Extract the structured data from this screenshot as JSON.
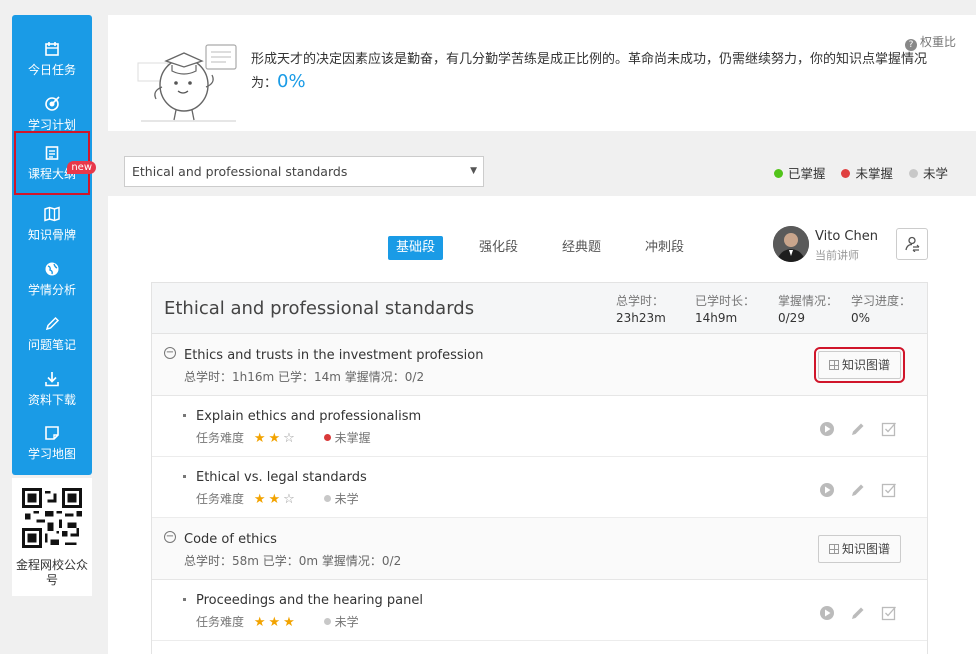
{
  "sidebar": {
    "items": [
      {
        "label": "今日任务",
        "icon": "calendar-icon"
      },
      {
        "label": "学习计划",
        "icon": "target-icon"
      },
      {
        "label": "课程大纲",
        "icon": "outline-icon",
        "badge": "new",
        "highlighted": true
      },
      {
        "label": "知识骨牌",
        "icon": "map-icon"
      },
      {
        "label": "学情分析",
        "icon": "globe-icon"
      },
      {
        "label": "问题笔记",
        "icon": "pencil-icon"
      },
      {
        "label": "资料下载",
        "icon": "download-icon"
      },
      {
        "label": "学习地图",
        "icon": "map-note-icon"
      }
    ],
    "qr_label": "金程网校公众号"
  },
  "banner": {
    "message": "形成天才的决定因素应该是勤奋，有几分勤学苦练是成正比例的。革命尚未成功，仍需继续努力，你的知识点掌握情况为：",
    "percent": "0%",
    "weight_link": "权重比"
  },
  "filter": {
    "selected_subject": "Ethical and professional standards",
    "legend": [
      {
        "label": "已掌握",
        "color": "#52c41a"
      },
      {
        "label": "未掌握",
        "color": "#e04040"
      },
      {
        "label": "未学",
        "color": "#c8c8c8"
      }
    ]
  },
  "tabs": [
    {
      "label": "基础段",
      "active": true
    },
    {
      "label": "强化段",
      "active": false
    },
    {
      "label": "经典题",
      "active": false
    },
    {
      "label": "冲刺段",
      "active": false
    }
  ],
  "lecturer": {
    "name": "Vito Chen",
    "role": "当前讲师"
  },
  "course": {
    "title": "Ethical and professional standards",
    "stats": [
      {
        "label": "总学时：",
        "value": "23h23m"
      },
      {
        "label": "已学时长：",
        "value": "14h9m"
      },
      {
        "label": "掌握情况：",
        "value": "0/29"
      },
      {
        "label": "学习进度：",
        "value": "0%"
      }
    ]
  },
  "chapters": [
    {
      "title": "Ethics and trusts in the investment profession",
      "meta": "总学时：1h16m   已学：14m   掌握情况：0/2",
      "button": "知识图谱",
      "tasks": [
        {
          "title": "Explain ethics and professionalism",
          "difficulty_label": "任务难度",
          "stars_filled": 2,
          "stars_total": 3,
          "status": "未掌握",
          "status_color": "#d93a3a"
        },
        {
          "title": "Ethical vs. legal standards",
          "difficulty_label": "任务难度",
          "stars_filled": 2,
          "stars_total": 3,
          "status": "未学",
          "status_color": "#c8c8c8"
        }
      ]
    },
    {
      "title": "Code of ethics",
      "meta": "总学时：58m   已学：0m   掌握情况：0/2",
      "button": "知识图谱",
      "tasks": [
        {
          "title": "Proceedings and the hearing panel",
          "difficulty_label": "任务难度",
          "stars_filled": 3,
          "stars_total": 3,
          "status": "未学",
          "status_color": "#c8c8c8"
        }
      ]
    }
  ],
  "colors": {
    "accent": "#1a9be6",
    "highlight_outline": "#d0152a",
    "star": "#f2a300"
  }
}
